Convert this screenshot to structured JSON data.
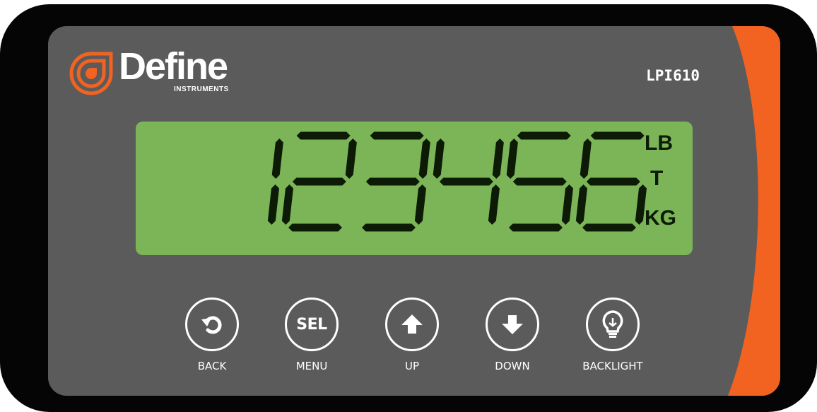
{
  "brand": {
    "name": "Define",
    "tagline": "INSTRUMENTS",
    "accent_color": "#f26322"
  },
  "device": {
    "model": "LPI610"
  },
  "display": {
    "reading": "123456",
    "units": [
      "LB",
      "T",
      "KG"
    ],
    "lcd_color": "#7bb558",
    "segment_color": "#0c1a06"
  },
  "buttons": [
    {
      "id": "back",
      "label": "BACK",
      "icon": "back-arrow-icon"
    },
    {
      "id": "select",
      "label": "MENU",
      "face_text": "SEL"
    },
    {
      "id": "up",
      "label": "UP",
      "icon": "up-arrow-icon"
    },
    {
      "id": "down",
      "label": "DOWN",
      "icon": "down-arrow-icon"
    },
    {
      "id": "backlight",
      "label": "BACKLIGHT",
      "icon": "lightbulb-icon"
    }
  ]
}
